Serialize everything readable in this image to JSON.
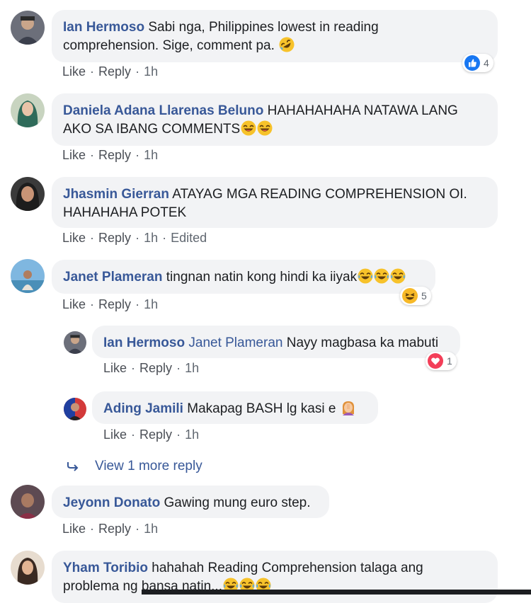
{
  "comments": [
    {
      "author": "Ian Hermoso",
      "text_line1": "Sabi nga, Philippines lowest in reading",
      "text_line2": "comprehension. Sige, comment pa.",
      "like": "Like",
      "reply": "Reply",
      "time": "1h",
      "reaction_count": "4"
    },
    {
      "author": "Daniela Adana Llarenas Beluno",
      "text_line1": "HAHAHAHAHA NATAWA LANG",
      "text_line2": "AKO SA IBANG COMMENTS",
      "like": "Like",
      "reply": "Reply",
      "time": "1h"
    },
    {
      "author": "Jhasmin Gierran",
      "text_line1": "ATAYAG MGA READING COMPREHENSION OI.",
      "text_line2": "HAHAHAHA POTEK",
      "like": "Like",
      "reply": "Reply",
      "time": "1h",
      "edited": "Edited"
    },
    {
      "author": "Janet Plameran",
      "text_line1": "tingnan natin kong hindi ka iiyak",
      "like": "Like",
      "reply": "Reply",
      "time": "1h",
      "reaction_count": "5"
    },
    {
      "author": "Jeyonn Donato",
      "text_line1": "Gawing mung euro step.",
      "like": "Like",
      "reply": "Reply",
      "time": "1h"
    },
    {
      "author": "Yham Toribio",
      "text_line1": "hahahah Reading Comprehension talaga ang",
      "text_line2": "problema ng bansa natin..."
    }
  ],
  "replies": [
    {
      "author": "Ian Hermoso",
      "mention": "Janet Plameran",
      "text_line1": "Nayy magbasa ka mabuti",
      "like": "Like",
      "reply": "Reply",
      "time": "1h",
      "reaction_count": "1"
    },
    {
      "author": "Ading Jamili",
      "text_line1": "Makapag BASH lg kasi e",
      "like": "Like",
      "reply": "Reply",
      "time": "1h"
    }
  ],
  "view_more": "View 1 more reply",
  "colors": {
    "author": "#385898",
    "bubble": "#f2f3f5",
    "like_blue": "#1877f2",
    "love_red": "#f33e58",
    "haha_yellow": "#f7b928"
  },
  "icons": {
    "like_reaction": "like-reaction-icon",
    "haha_reaction": "haha-reaction-icon",
    "love_reaction": "love-reaction-icon",
    "reply_arrow": "reply-arrow-icon"
  }
}
